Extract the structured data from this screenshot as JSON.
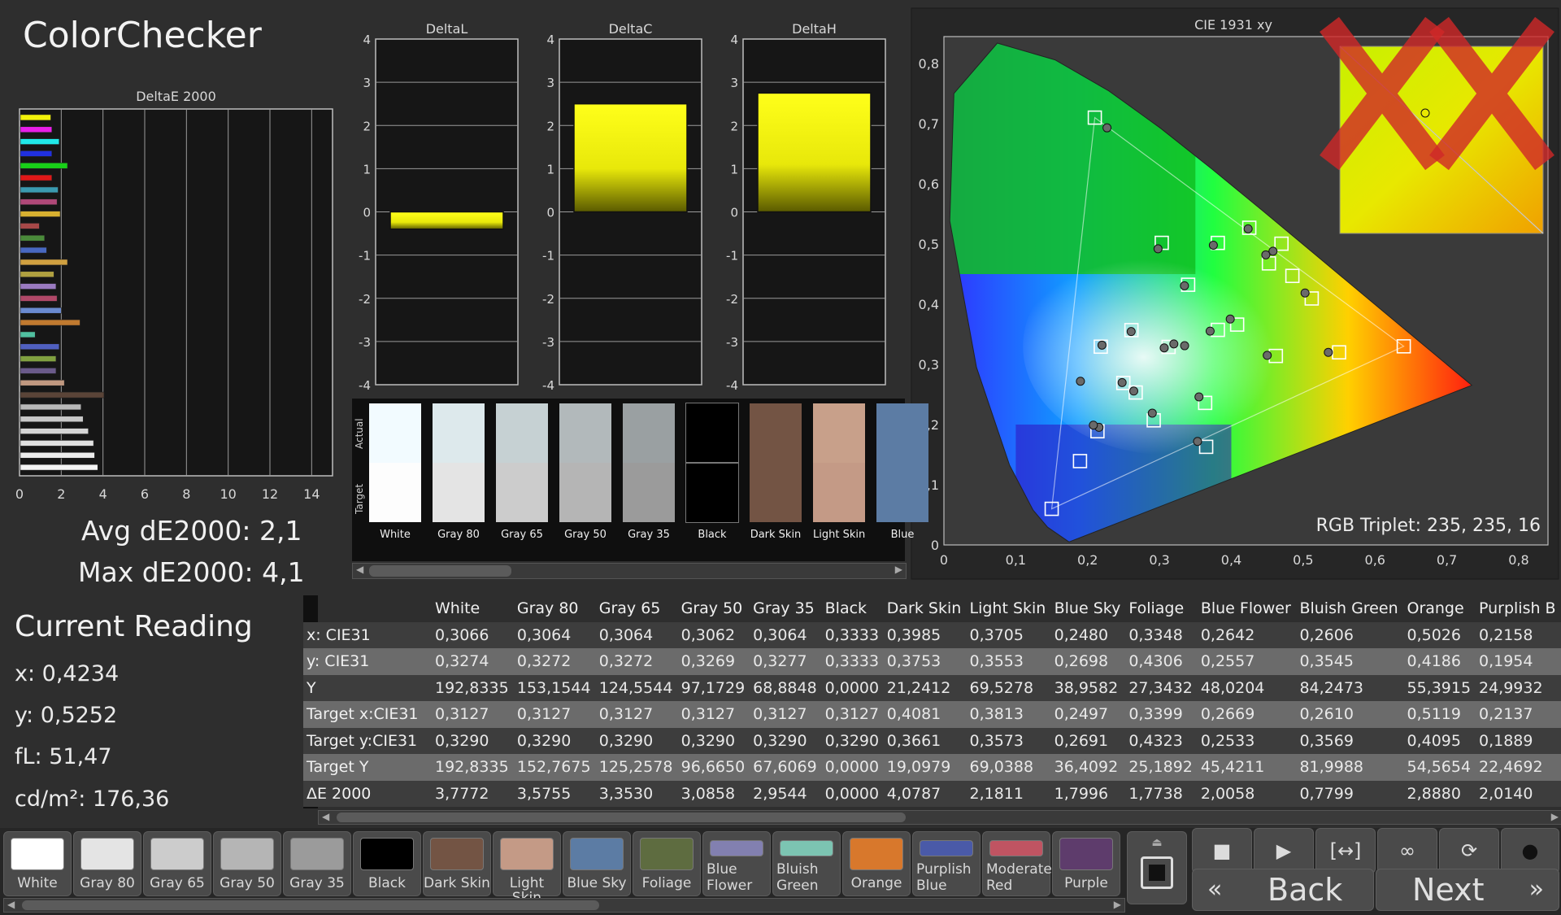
{
  "app": {
    "title": "ColorChecker"
  },
  "summary": {
    "avg": "Avg dE2000: 2,1",
    "max": "Max dE2000: 4,1"
  },
  "current_reading": {
    "title": "Current Reading",
    "x": "x: 0,4234",
    "y": "y: 0,5252",
    "fl": "fL: 51,47",
    "cdm2": "cd/m²: 176,36"
  },
  "chart_data": [
    {
      "type": "bar",
      "title": "DeltaE 2000",
      "orientation": "horizontal",
      "xlim": [
        0,
        15
      ],
      "x_ticks": [
        "0",
        "2",
        "4",
        "6",
        "8",
        "10",
        "12",
        "14"
      ],
      "colors": [
        "#f2f20a",
        "#e81ee8",
        "#20e8e8",
        "#2030e0",
        "#18d018",
        "#e01818",
        "#3a9ab0",
        "#b04878",
        "#d8b030",
        "#a84848",
        "#4a8a3a",
        "#4868c0",
        "#d0a040",
        "#b0a040",
        "#9a7ac0",
        "#b04868",
        "#6a8ad0",
        "#c07a30",
        "#50c0a0",
        "#5060c0",
        "#80a040",
        "#6a5a8a",
        "#c09880",
        "#5a4438",
        "#b8b8b8",
        "#c8c8c8",
        "#d4d4d4",
        "#e0e0e0",
        "#ececec",
        "#f4f4f4"
      ],
      "values": [
        1.5,
        1.55,
        1.9,
        1.55,
        2.3,
        1.55,
        1.85,
        1.8,
        1.95,
        0.95,
        1.2,
        1.3,
        2.3,
        1.65,
        1.75,
        1.8,
        2.0,
        2.9,
        0.75,
        1.9,
        1.75,
        1.75,
        2.15,
        4.05,
        2.95,
        3.05,
        3.3,
        3.55,
        3.6,
        3.75
      ]
    },
    {
      "type": "bar",
      "title": "DeltaL",
      "ylim": [
        -4,
        4
      ],
      "y_ticks": [
        "4",
        "3",
        "2",
        "1",
        "0",
        "-1",
        "-2",
        "-3",
        "-4"
      ],
      "values": [
        -0.4
      ]
    },
    {
      "type": "bar",
      "title": "DeltaC",
      "ylim": [
        -4,
        4
      ],
      "y_ticks": [
        "4",
        "3",
        "2",
        "1",
        "0",
        "-1",
        "-2",
        "-3",
        "-4"
      ],
      "values": [
        2.5
      ]
    },
    {
      "type": "bar",
      "title": "DeltaH",
      "ylim": [
        -4,
        4
      ],
      "y_ticks": [
        "4",
        "3",
        "2",
        "1",
        "0",
        "-1",
        "-2",
        "-3",
        "-4"
      ],
      "values": [
        2.75
      ]
    },
    {
      "type": "scatter",
      "title": "CIE 1931 xy",
      "xlim": [
        0,
        0.85
      ],
      "ylim": [
        0,
        0.85
      ],
      "x_ticks": [
        "0",
        "0,1",
        "0,2",
        "0,3",
        "0,4",
        "0,5",
        "0,6",
        "0,7",
        "0,8"
      ],
      "y_ticks": [
        "0",
        "0,1",
        "0,2",
        "0,3",
        "0,4",
        "0,5",
        "0,6",
        "0,7",
        "0,8"
      ],
      "gamut": [
        [
          0.64,
          0.33
        ],
        [
          0.21,
          0.71
        ],
        [
          0.15,
          0.06
        ]
      ],
      "targets": [
        [
          0.3127,
          0.329
        ],
        [
          0.4081,
          0.3661
        ],
        [
          0.3813,
          0.3573
        ],
        [
          0.2497,
          0.2691
        ],
        [
          0.3399,
          0.4323
        ],
        [
          0.2669,
          0.2533
        ],
        [
          0.261,
          0.3569
        ],
        [
          0.5119,
          0.4095
        ],
        [
          0.2137,
          0.1889
        ],
        [
          0.4698,
          0.5005
        ],
        [
          0.3812,
          0.5018
        ],
        [
          0.4523,
          0.4678
        ],
        [
          0.1894,
          0.1393
        ],
        [
          0.3636,
          0.236
        ],
        [
          0.2183,
          0.3294
        ],
        [
          0.3032,
          0.5019
        ],
        [
          0.64,
          0.33
        ],
        [
          0.21,
          0.71
        ],
        [
          0.15,
          0.06
        ],
        [
          0.425,
          0.527
        ],
        [
          0.485,
          0.447
        ],
        [
          0.462,
          0.314
        ],
        [
          0.55,
          0.32
        ],
        [
          0.365,
          0.163
        ],
        [
          0.292,
          0.207
        ]
      ],
      "actuals": [
        [
          0.3066,
          0.3274
        ],
        [
          0.3985,
          0.3753
        ],
        [
          0.3705,
          0.3553
        ],
        [
          0.248,
          0.2698
        ],
        [
          0.3348,
          0.4306
        ],
        [
          0.2642,
          0.2557
        ],
        [
          0.2606,
          0.3545
        ],
        [
          0.5026,
          0.4186
        ],
        [
          0.2158,
          0.1954
        ],
        [
          0.458,
          0.488
        ],
        [
          0.375,
          0.498
        ],
        [
          0.448,
          0.482
        ],
        [
          0.227,
          0.693
        ],
        [
          0.355,
          0.246
        ],
        [
          0.22,
          0.332
        ],
        [
          0.298,
          0.492
        ],
        [
          0.4234,
          0.5252
        ],
        [
          0.45,
          0.315
        ],
        [
          0.535,
          0.32
        ],
        [
          0.353,
          0.172
        ],
        [
          0.29,
          0.219
        ],
        [
          0.335,
          0.331
        ],
        [
          0.32,
          0.334
        ],
        [
          0.208,
          0.199
        ],
        [
          0.19,
          0.272
        ]
      ],
      "annotation": "RGB Triplet: 235, 235, 16"
    }
  ],
  "swatches": {
    "side_actual": "Actual",
    "side_target": "Target",
    "items": [
      {
        "label": "White",
        "actual": "#f2fbff",
        "target": "#fdfdfd"
      },
      {
        "label": "Gray 80",
        "actual": "#dde9ec",
        "target": "#e4e4e4"
      },
      {
        "label": "Gray 65",
        "actual": "#c6d1d3",
        "target": "#cccccc"
      },
      {
        "label": "Gray 50",
        "actual": "#b2b9bb",
        "target": "#b5b5b5"
      },
      {
        "label": "Gray 35",
        "actual": "#9aa0a2",
        "target": "#9b9b9b"
      },
      {
        "label": "Black",
        "actual": "#000000",
        "target": "#000000"
      },
      {
        "label": "Dark Skin",
        "actual": "#735444",
        "target": "#735444"
      },
      {
        "label": "Light Skin",
        "actual": "#c8a08a",
        "target": "#c49a86"
      },
      {
        "label": "Blue",
        "actual": "#5c7ca4",
        "target": "#5c7ca4"
      }
    ]
  },
  "table": {
    "headers": [
      "",
      "White",
      "Gray 80",
      "Gray 65",
      "Gray 50",
      "Gray 35",
      "Black",
      "Dark Skin",
      "Light Skin",
      "Blue Sky",
      "Foliage",
      "Blue Flower",
      "Bluish Green",
      "Orange",
      "Purplish B"
    ],
    "rows": [
      {
        "label": "x: CIE31",
        "values": [
          "0,3066",
          "0,3064",
          "0,3064",
          "0,3062",
          "0,3064",
          "0,3333",
          "0,3985",
          "0,3705",
          "0,2480",
          "0,3348",
          "0,2642",
          "0,2606",
          "0,5026",
          "0,2158"
        ]
      },
      {
        "label": "y: CIE31",
        "values": [
          "0,3274",
          "0,3272",
          "0,3272",
          "0,3269",
          "0,3277",
          "0,3333",
          "0,3753",
          "0,3553",
          "0,2698",
          "0,4306",
          "0,2557",
          "0,3545",
          "0,4186",
          "0,1954"
        ]
      },
      {
        "label": "Y",
        "values": [
          "192,8335",
          "153,1544",
          "124,5544",
          "97,1729",
          "68,8848",
          "0,0000",
          "21,2412",
          "69,5278",
          "38,9582",
          "27,3432",
          "48,0204",
          "84,2473",
          "55,3915",
          "24,9932"
        ]
      },
      {
        "label": "Target x:CIE31",
        "values": [
          "0,3127",
          "0,3127",
          "0,3127",
          "0,3127",
          "0,3127",
          "0,3127",
          "0,4081",
          "0,3813",
          "0,2497",
          "0,3399",
          "0,2669",
          "0,2610",
          "0,5119",
          "0,2137"
        ]
      },
      {
        "label": "Target y:CIE31",
        "values": [
          "0,3290",
          "0,3290",
          "0,3290",
          "0,3290",
          "0,3290",
          "0,3290",
          "0,3661",
          "0,3573",
          "0,2691",
          "0,4323",
          "0,2533",
          "0,3569",
          "0,4095",
          "0,1889"
        ]
      },
      {
        "label": "Target Y",
        "values": [
          "192,8335",
          "152,7675",
          "125,2578",
          "96,6650",
          "67,6069",
          "0,0000",
          "19,0979",
          "69,0388",
          "36,4092",
          "25,1892",
          "45,4211",
          "81,9988",
          "54,5654",
          "22,4692"
        ]
      },
      {
        "label": "ΔE 2000",
        "values": [
          "3,7772",
          "3,5755",
          "3,3530",
          "3,0858",
          "2,9544",
          "0,0000",
          "4,0787",
          "2,1811",
          "1,7996",
          "1,7738",
          "2,0058",
          "0,7799",
          "2,8880",
          "2,0140"
        ]
      }
    ]
  },
  "patches": [
    {
      "label": "White",
      "color": "#ffffff"
    },
    {
      "label": "Gray 80",
      "color": "#e4e4e4"
    },
    {
      "label": "Gray 65",
      "color": "#cccccc"
    },
    {
      "label": "Gray 50",
      "color": "#b5b5b5"
    },
    {
      "label": "Gray 35",
      "color": "#9b9b9b"
    },
    {
      "label": "Black",
      "color": "#000000"
    },
    {
      "label": "Dark Skin",
      "color": "#735444"
    },
    {
      "label": "Light Skin",
      "color": "#c49a86"
    },
    {
      "label": "Blue Sky",
      "color": "#5c7ca4"
    },
    {
      "label": "Foliage",
      "color": "#5e6c40"
    },
    {
      "label": "Blue Flower",
      "color": "#8280b0",
      "two_line": true,
      "l1": "Blue",
      "l2": "Flower"
    },
    {
      "label": "Bluish Green",
      "color": "#7cc4b2",
      "two_line": true,
      "l1": "Bluish",
      "l2": "Green"
    },
    {
      "label": "Orange",
      "color": "#d8782c"
    },
    {
      "label": "Purplish Blue",
      "color": "#4a5aa8",
      "two_line": true,
      "l1": "Purplish",
      "l2": "Blue"
    },
    {
      "label": "Moderate Red",
      "color": "#c05462",
      "two_line": true,
      "l1": "Moderate",
      "l2": "Red"
    },
    {
      "label": "Purple",
      "color": "#5e3c6c"
    }
  ],
  "nav": {
    "back": "Back",
    "next": "Next"
  },
  "icons": {
    "back": "chevron-double-left-icon",
    "next": "chevron-double-right-icon"
  }
}
